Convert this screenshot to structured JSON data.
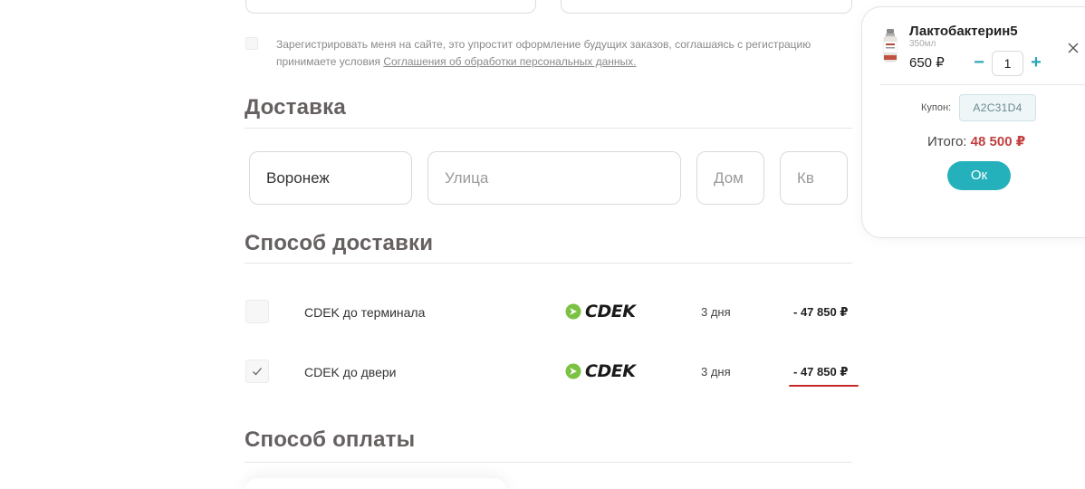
{
  "registration": {
    "text": "Зарегистрировать меня на сайте, это упростит оформление будущих заказов, соглашаясь с регистрацию принимаете условия ",
    "link": "Соглашения об обработки персональных данных."
  },
  "delivery": {
    "title": "Доставка",
    "city": "Воронеж",
    "street_placeholder": "Улица",
    "house_placeholder": "Дом",
    "apt_placeholder": "Кв"
  },
  "shipping_method": {
    "title": "Способ доставки",
    "options": [
      {
        "name": "CDEK до терминала",
        "carrier": "CDEK",
        "days": "3 дня",
        "price": "- 47 850 ₽",
        "checked": false
      },
      {
        "name": "CDEK до двери",
        "carrier": "CDEK",
        "days": "3 дня",
        "price": "- 47 850 ₽",
        "checked": true
      }
    ]
  },
  "payment": {
    "title": "Способ оплаты"
  },
  "cart": {
    "product_name": "Лактобактерин5",
    "volume": "350мл",
    "price": "650 ₽",
    "quantity": "1",
    "minus": "−",
    "plus": "+",
    "coupon_label": "Купон:",
    "coupon_value": "A2C31D4",
    "total_label": "Итого: ",
    "total_value": "48 500 ₽",
    "ok_label": "Ок"
  },
  "colors": {
    "accent": "#25b1bb",
    "total_red": "#c24040",
    "underline_red": "#c62828",
    "cdek_green": "#7bc142"
  }
}
